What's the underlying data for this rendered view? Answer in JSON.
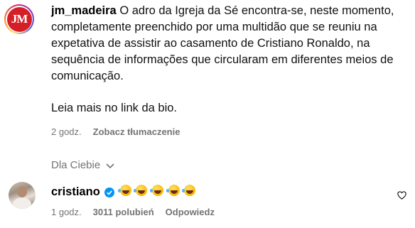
{
  "post": {
    "username": "jm_madeira",
    "avatar_text": "JM",
    "caption": "O adro da Igreja da Sé encontra-se, neste momento, completamente preenchido por uma multidão que se reuniu na expetativa de assistir ao casamento de Cristiano Ronaldo, na sequência de informações que circularam em diferentes meios de comunicação.",
    "more_text": "Leia mais no link da bio.",
    "time": "2 godz.",
    "translate_label": "Zobacz tłumaczenie"
  },
  "filter": {
    "label": "Dla Ciebie",
    "icon": "chevron-down-icon"
  },
  "comment": {
    "username": "cristiano",
    "verified_icon": "verified-badge-icon",
    "emoji_text": "🤣🤣🤣🤣🤣",
    "emoji_count": 5,
    "time": "1 godz.",
    "likes": "3011 polubień",
    "reply_label": "Odpowiedz",
    "like_icon": "heart-outline-icon"
  },
  "colors": {
    "jm_red": "#d51f27",
    "muted": "#737373",
    "verified_blue": "#0095f6"
  }
}
